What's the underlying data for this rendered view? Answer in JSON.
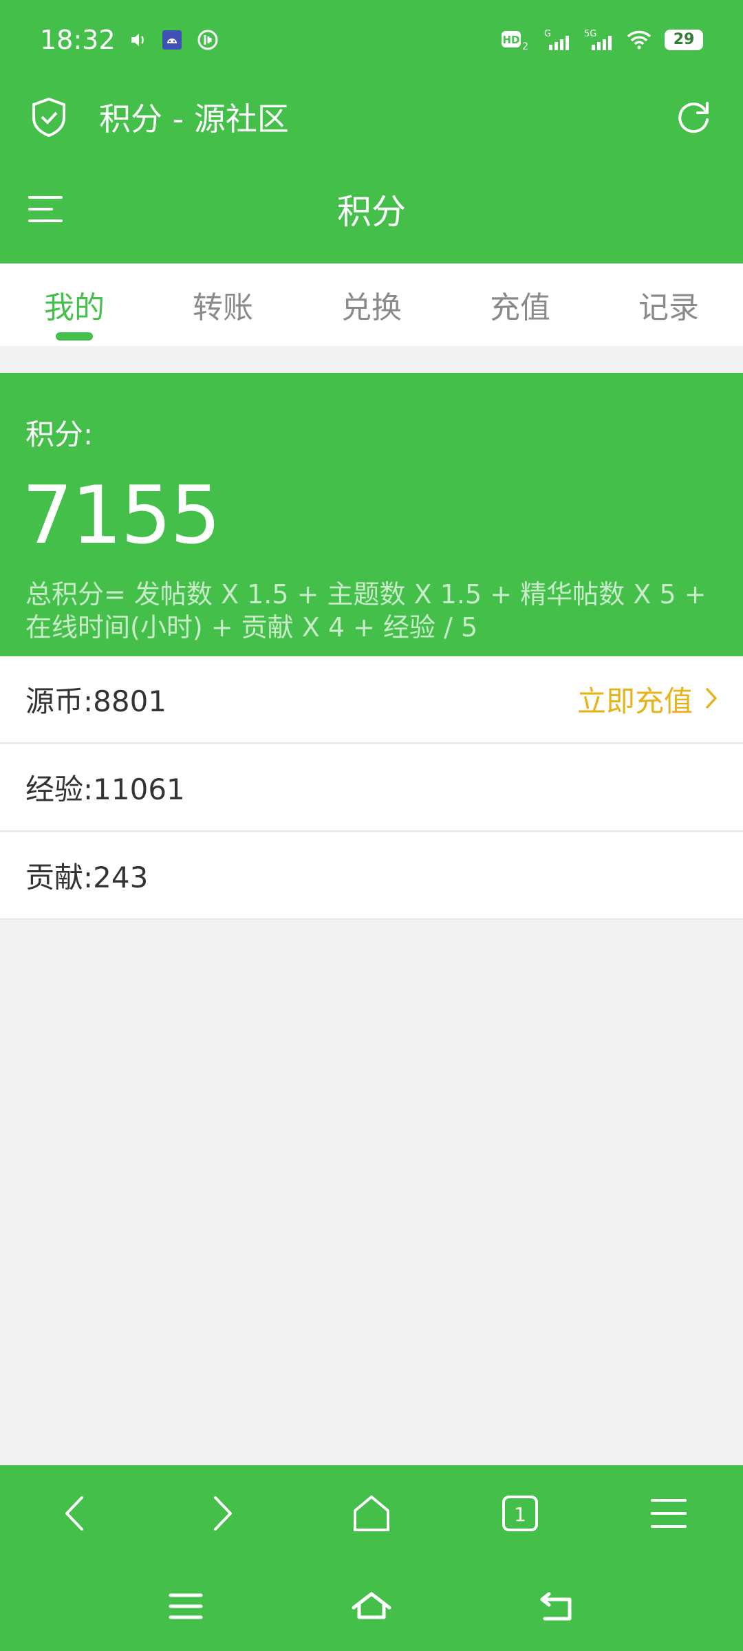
{
  "status_bar": {
    "time": "18:32",
    "hd_label": "HD",
    "hd_sub": "2",
    "sig1_label": "G",
    "sig2_label": "5G",
    "battery": "29"
  },
  "browser": {
    "title": "积分 - 源社区"
  },
  "page": {
    "title": "积分"
  },
  "tabs": [
    {
      "label": "我的",
      "active": true
    },
    {
      "label": "转账"
    },
    {
      "label": "兑换"
    },
    {
      "label": "充值"
    },
    {
      "label": "记录"
    }
  ],
  "points_card": {
    "label": "积分:",
    "value": "7155",
    "formula": "总积分= 发帖数 X 1.5 + 主题数 X 1.5 + 精华帖数 X 5 + 在线时间(小时) + 贡献 X 4 + 经验 / 5"
  },
  "rows": [
    {
      "label": "源币:8801",
      "action": "立即充值"
    },
    {
      "label": "经验:11061"
    },
    {
      "label": "贡献:243"
    }
  ],
  "bottom_nav": {
    "tab_count": "1"
  },
  "colors": {
    "primary": "#44bf4a",
    "accent": "#e8b21a"
  }
}
